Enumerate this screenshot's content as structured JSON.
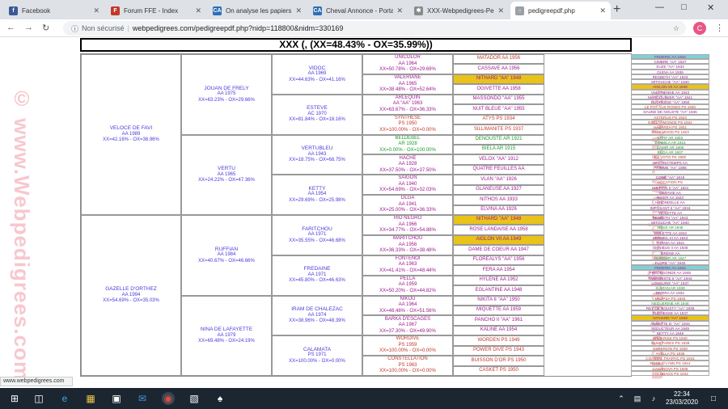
{
  "tabs": [
    {
      "label": "Facebook",
      "icon": "facebook-icon",
      "color": "#3b5998",
      "glyph": "f"
    },
    {
      "label": "Forum FFE - Index",
      "icon": "ffe-icon",
      "color": "#c0392b",
      "glyph": "F"
    },
    {
      "label": "On analyse les papiers p",
      "icon": "ca-icon",
      "color": "#2c6fb5",
      "glyph": "CA"
    },
    {
      "label": "Cheval Annonce - Portail",
      "icon": "ca-icon",
      "color": "#2c6fb5",
      "glyph": "CA"
    },
    {
      "label": "XXX-Webpedigrees-Pe",
      "icon": "pedigree-icon",
      "color": "#8a8a8a",
      "glyph": "✱"
    },
    {
      "label": "pedigreepdf.php",
      "icon": "page-icon",
      "color": "#9aa0a6",
      "glyph": "○"
    }
  ],
  "url": {
    "prefix": "Non sécurisé",
    "address": "webpedigrees.com/pedigreepdf.php?nidp=118800&nidm=330169"
  },
  "avatar": "C",
  "watermark": "© www.Webpedigrees.com",
  "page_title": "XXX (, (XX=48.43% - OX=35.99%))",
  "gen1": [
    {
      "name": "VELOCE DE FAVI",
      "breed": "AA 1989",
      "stat": "XX=42.16% - OX=36.96%"
    },
    {
      "name": "GAZELLE D'ORTHEZ",
      "breed": "AA 1994",
      "stat": "XX=54.69% - OX=35.03%"
    }
  ],
  "gen2": [
    {
      "name": "JOUAN DE FRELY",
      "breed": "AA 1975",
      "stat": "XX=63.23% - OX=29.66%"
    },
    {
      "name": "VERTU",
      "breed": "AA 1965",
      "stat": "XX=24.22% - OX=47.36%"
    },
    {
      "name": "RUFFIAN",
      "breed": "AA 1984",
      "stat": "XX=40.67% - OX=46.66%"
    },
    {
      "name": "NINA DE LAFAYETTE",
      "breed": "AA 1979",
      "stat": "XX=69.48% - OX=24.19%"
    }
  ],
  "gen3": [
    {
      "name": "VIDOC",
      "breed": "AA 1969",
      "stat": "XX=44.63% - OX=41.16%"
    },
    {
      "name": "ESTEVE",
      "breed": "AC 1970",
      "stat": "XX=81.84% - OX=18.16%"
    },
    {
      "name": "VERTUBLEU",
      "breed": "AA 1943",
      "stat": "XX=18.75% - OX=68.75%"
    },
    {
      "name": "KETTY",
      "breed": "AA 1954",
      "stat": "XX=29.69% - OX=25.98%"
    },
    {
      "name": "FARITCHOU",
      "breed": "AA 1971",
      "stat": "XX=35.55% - OX=46.68%"
    },
    {
      "name": "FREDAINE",
      "breed": "AA 1971",
      "stat": "XX=45.80% - OX=46.63%"
    },
    {
      "name": "IRAM DE CHALEZAC",
      "breed": "AA 1974",
      "stat": "XX=38.96% - OX=48.39%"
    },
    {
      "name": "CALAMATA",
      "breed": "PS 1971",
      "stat": "XX=100.00% - OX=0.00%"
    }
  ],
  "gen4": [
    {
      "name": "UNICOLOR",
      "breed": "AA 1964",
      "stat": "XX=50.78% - OX=29.69%",
      "color": "#9c1a8f"
    },
    {
      "name": "VALERIANE",
      "breed": "AA 1965",
      "stat": "XX=38.48% - OX=52.64%",
      "color": "#9c1a8f"
    },
    {
      "name": "ARLEQUIN",
      "breed": "AA \"AA\" 1963",
      "stat": "XX=63.67% - OX=36.33%",
      "color": "#9c1a8f"
    },
    {
      "name": "SYNTHESE",
      "breed": "PS 1950",
      "stat": "XX=100.00% - OX=0.00%",
      "color": "#c0392b"
    },
    {
      "name": "BELDEBEL",
      "breed": "AR 1928",
      "stat": "XX=0.00% - OX=100.00%",
      "color": "#1a9a2c"
    },
    {
      "name": "HACHE",
      "breed": "AA 1928",
      "stat": "XX=37.50% - OX=37.50%",
      "color": "#9c1a8f"
    },
    {
      "name": "SAIGON",
      "breed": "AA 1940",
      "stat": "XX=54.69% - OX=32.03%",
      "color": "#9c1a8f"
    },
    {
      "name": "OLGA",
      "breed": "AA 1941",
      "stat": "XX=25.00% - OX=36.33%",
      "color": "#9c1a8f"
    },
    {
      "name": "RIO NEGRO",
      "breed": "AA 1966",
      "stat": "XX=34.77% - OX=54.88%",
      "color": "#9c1a8f"
    },
    {
      "name": "MARITCHOU",
      "breed": "AA 1956",
      "stat": "XX=36.33% - OX=38.48%",
      "color": "#9c1a8f"
    },
    {
      "name": "FONTENOI",
      "breed": "AA 1963",
      "stat": "XX=41.41% - OX=48.44%",
      "color": "#9c1a8f"
    },
    {
      "name": "PELLA",
      "breed": "AA 1959",
      "stat": "XX=50.20% - OX=44.82%",
      "color": "#9c1a8f"
    },
    {
      "name": "NIKOU",
      "breed": "AA 1964",
      "stat": "XX=46.48% - OX=51.56%",
      "color": "#9c1a8f"
    },
    {
      "name": "BARKA D'ESCAGES",
      "breed": "AA 1967",
      "stat": "XX=37.30% - OX=49.90%",
      "color": "#9c1a8f"
    },
    {
      "name": "WORDIVE",
      "breed": "PS 1959",
      "stat": "XX=100.00% - OX=0.00%",
      "color": "#c0392b"
    },
    {
      "name": "CONSTELLATION",
      "breed": "PS 1963",
      "stat": "XX=100.00% - OX=0.00%",
      "color": "#c0392b"
    }
  ],
  "gen5": [
    {
      "name": "MATADOR AA 1956",
      "color": "#c0392b",
      "bg": ""
    },
    {
      "name": "CASSAVE AA 1956",
      "color": "#9c1a8f",
      "bg": ""
    },
    {
      "name": "NITHARD \"AA\" 1948",
      "color": "#9c1a8f",
      "bg": "#e9c21a"
    },
    {
      "name": "OGIVETTE AA 1958",
      "color": "#9c1a8f",
      "bg": ""
    },
    {
      "name": "MASSONDO \"AA\" 1955",
      "color": "#9c1a8f",
      "bg": ""
    },
    {
      "name": "NUIT BLEUE \"AA\" 1955",
      "color": "#9c1a8f",
      "bg": ""
    },
    {
      "name": "ATYS PS 1934",
      "color": "#c0392b",
      "bg": ""
    },
    {
      "name": "SILLIMANITE PS 1937",
      "color": "#c0392b",
      "bg": ""
    },
    {
      "name": "DENOUSTE AR 1921",
      "color": "#1a9a2c",
      "bg": ""
    },
    {
      "name": "BIELA AR 1915",
      "color": "#1a9a2c",
      "bg": ""
    },
    {
      "name": "VELOX \"AA\" 1912",
      "color": "#9c1a8f",
      "bg": ""
    },
    {
      "name": "QUATRE FEUILLES AA",
      "color": "#9c1a8f",
      "bg": ""
    },
    {
      "name": "VLAN \"AA\" 1926",
      "color": "#9c1a8f",
      "bg": ""
    },
    {
      "name": "GLANEUSE AA 1927",
      "color": "#9c1a8f",
      "bg": ""
    },
    {
      "name": "NITHOS AA 1933",
      "color": "#9c1a8f",
      "bg": ""
    },
    {
      "name": "ELVINA AA 1926",
      "color": "#9c1a8f",
      "bg": ""
    },
    {
      "name": "NITHARD \"AA\" 1948",
      "color": "#9c1a8f",
      "bg": "#e9c21a"
    },
    {
      "name": "ROSE LANDAISE AA 1958",
      "color": "#9c1a8f",
      "bg": ""
    },
    {
      "name": "AIGLON VII AA 1949",
      "color": "#9c1a8f",
      "bg": "#e9c21a"
    },
    {
      "name": "DAME DE COEUR AA 1947",
      "color": "#9c1a8f",
      "bg": ""
    },
    {
      "name": "FLOREALYS \"AA\" 1956",
      "color": "#9c1a8f",
      "bg": ""
    },
    {
      "name": "FERA AA 1954",
      "color": "#9c1a8f",
      "bg": ""
    },
    {
      "name": "HYLENE AA 1952",
      "color": "#9c1a8f",
      "bg": ""
    },
    {
      "name": "EGLANTINE AA 1948",
      "color": "#9c1a8f",
      "bg": ""
    },
    {
      "name": "NIKITA II \"AA\" 1950",
      "color": "#9c1a8f",
      "bg": ""
    },
    {
      "name": "MIQUETTE AA 1959",
      "color": "#9c1a8f",
      "bg": ""
    },
    {
      "name": "PANCHO II \"AA\" 1961",
      "color": "#9c1a8f",
      "bg": ""
    },
    {
      "name": "KALINE AA 1954",
      "color": "#9c1a8f",
      "bg": ""
    },
    {
      "name": "WORDEN PS 1949",
      "color": "#c0392b",
      "bg": ""
    },
    {
      "name": "POWER DIVE PS 1943",
      "color": "#c0392b",
      "bg": ""
    },
    {
      "name": "BUISSON D'OR PS 1950",
      "color": "#c0392b",
      "bg": ""
    },
    {
      "name": "CASKET PS 1950",
      "color": "#c0392b",
      "bg": ""
    }
  ],
  "gen6": [
    {
      "name": "FEDERIC AA 1944",
      "color": "#9c1a8f",
      "bg": "#7fd1d8"
    },
    {
      "name": "CIMBRE \"AA\" 1937",
      "color": "#9c1a8f",
      "bg": ""
    },
    {
      "name": "SUZE \"AA\" 1933",
      "color": "#9c1a8f",
      "bg": ""
    },
    {
      "name": "QUINA AA 1936",
      "color": "#9c1a8f",
      "bg": ""
    },
    {
      "name": "RESBETH \"AA\" 1943",
      "color": "#9c1a8f",
      "bg": ""
    },
    {
      "name": "MITOUCHE \"AA\" 1940",
      "color": "#9c1a8f",
      "bg": ""
    },
    {
      "name": "AIGLON VII AA 1949",
      "color": "#9c1a8f",
      "bg": "#e9c21a"
    },
    {
      "name": "VALERIENNE AA 1943",
      "color": "#9c1a8f",
      "bg": ""
    },
    {
      "name": "MAROQUINIER \"AA\" 1941",
      "color": "#9c1a8f",
      "bg": ""
    },
    {
      "name": "DUCHESSE \"AA\" 1950",
      "color": "#9c1a8f",
      "bg": ""
    },
    {
      "name": "LE POT AUX ROSES PS 1940",
      "color": "#c0392b",
      "bg": ""
    },
    {
      "name": "DAUNE DE NOUSTE \"AA\" 1936",
      "color": "#9c1a8f",
      "bg": ""
    },
    {
      "name": "ASTERUS PS 1923",
      "color": "#c0392b",
      "bg": ""
    },
    {
      "name": "ESCLARMONDE PS 1924",
      "color": "#c0392b",
      "bg": ""
    },
    {
      "name": "HAZAREH PS 1921",
      "color": "#c0392b",
      "bg": ""
    },
    {
      "name": "SILLY MOOD PS 1923",
      "color": "#c0392b",
      "bg": ""
    },
    {
      "name": "LATIF AR 1903",
      "color": "#1a9a2c",
      "bg": ""
    },
    {
      "name": "DJAMILA AR 1915",
      "color": "#1a9a2c",
      "bg": ""
    },
    {
      "name": "SAMIR AR 1906",
      "color": "#1a9a2c",
      "bg": ""
    },
    {
      "name": "BEGA AR 1907",
      "color": "#1a9a2c",
      "bg": ""
    },
    {
      "name": "EX VOTO PS 1900",
      "color": "#c0392b",
      "bg": ""
    },
    {
      "name": "VA LONGTEMPS AA",
      "color": "#9c1a8f",
      "bg": ""
    },
    {
      "name": "PRIMME \"AA\" 1896",
      "color": "#9c1a8f",
      "bg": ""
    },
    {
      "name": "",
      "color": "#9c1a8f",
      "bg": ""
    },
    {
      "name": "CONE \"AA\" 1919",
      "color": "#9c1a8f",
      "bg": ""
    },
    {
      "name": "VOCATION PS",
      "color": "#c0392b",
      "bg": ""
    },
    {
      "name": "VULPIAN II \"AA\" 1921",
      "color": "#9c1a8f",
      "bg": ""
    },
    {
      "name": "OCTAVIE AA",
      "color": "#9c1a8f",
      "bg": ""
    },
    {
      "name": "NIGER AA 1923",
      "color": "#9c1a8f",
      "bg": ""
    },
    {
      "name": "HIRONDELLE AA",
      "color": "#9c1a8f",
      "bg": ""
    },
    {
      "name": "IMPOSANT II \"AA\" 1916",
      "color": "#9c1a8f",
      "bg": ""
    },
    {
      "name": "VIOLETTE AA",
      "color": "#9c1a8f",
      "bg": ""
    },
    {
      "name": "RESBETH \"AA\" 1943",
      "color": "#9c1a8f",
      "bg": ""
    },
    {
      "name": "MITOUCHE \"AA\" 1940",
      "color": "#9c1a8f",
      "bg": ""
    },
    {
      "name": "MEKE AR 1948",
      "color": "#1a9a2c",
      "bg": ""
    },
    {
      "name": "VIOLETTE AA 1943",
      "color": "#9c1a8f",
      "bg": ""
    },
    {
      "name": "VERMEIL III AA 1943",
      "color": "#9c1a8f",
      "bg": ""
    },
    {
      "name": "TITANIA AA 1941",
      "color": "#9c1a8f",
      "bg": ""
    },
    {
      "name": "OMNIBUS II AA 1936",
      "color": "#9c1a8f",
      "bg": ""
    },
    {
      "name": "SIRENE AA",
      "color": "#9c1a8f",
      "bg": ""
    },
    {
      "name": "OUROUR AR 1947",
      "color": "#1a9a2c",
      "bg": ""
    },
    {
      "name": "FLORE \"AA\" 1945",
      "color": "#9c1a8f",
      "bg": ""
    },
    {
      "name": "FEDERIC AA 1944",
      "color": "#9c1a8f",
      "bg": "#7fd1d8"
    },
    {
      "name": "FREDEGONDE AA 1948",
      "color": "#9c1a8f",
      "bg": ""
    },
    {
      "name": "FANFARISTE II \"AA\" 1944",
      "color": "#9c1a8f",
      "bg": ""
    },
    {
      "name": "LONGUINE \"AA\" 1937",
      "color": "#9c1a8f",
      "bg": ""
    },
    {
      "name": "SULTAN AR 1938",
      "color": "#1a9a2c",
      "bg": ""
    },
    {
      "name": "MYRRA AA 1934",
      "color": "#9c1a8f",
      "bg": ""
    },
    {
      "name": "MICIPSA PS 1945",
      "color": "#c0392b",
      "bg": ""
    },
    {
      "name": "NEGUERINE AR 1946",
      "color": "#1a9a2c",
      "bg": ""
    },
    {
      "name": "REY DE NOUSTY \"AA\" 1938",
      "color": "#9c1a8f",
      "bg": ""
    },
    {
      "name": "DUCHESSE AA 1947",
      "color": "#9c1a8f",
      "bg": ""
    },
    {
      "name": "NITHARD \"AA\" 1948",
      "color": "#9c1a8f",
      "bg": "#e9c21a"
    },
    {
      "name": "ANNETTE III \"AA\" 1944",
      "color": "#9c1a8f",
      "bg": ""
    },
    {
      "name": "SEDUCTEUR AA 1949",
      "color": "#9c1a8f",
      "bg": ""
    },
    {
      "name": "BETTY AA 1948",
      "color": "#9c1a8f",
      "bg": ""
    },
    {
      "name": "WILD RISK PS 1940",
      "color": "#c0392b",
      "bg": ""
    },
    {
      "name": "SANS TARES PS 1939",
      "color": "#c0392b",
      "bg": ""
    },
    {
      "name": "HYPERION PS 1930",
      "color": "#c0392b",
      "bg": ""
    },
    {
      "name": "AVELLA PS 1936",
      "color": "#c0392b",
      "bg": ""
    },
    {
      "name": "COASTAL TRAFFIC PS 1941",
      "color": "#c0392b",
      "bg": ""
    },
    {
      "name": "ROSE O'LYNN PS 1944",
      "color": "#c0392b",
      "bg": ""
    },
    {
      "name": "CASANOVA PS 1936",
      "color": "#c0392b",
      "bg": ""
    },
    {
      "name": "GOLDBAGS PS 1942",
      "color": "#c0392b",
      "bg": ""
    }
  ],
  "status_url": "www.webpedigrees.com",
  "clock": {
    "time": "22:34",
    "date": "23/03/2020"
  }
}
